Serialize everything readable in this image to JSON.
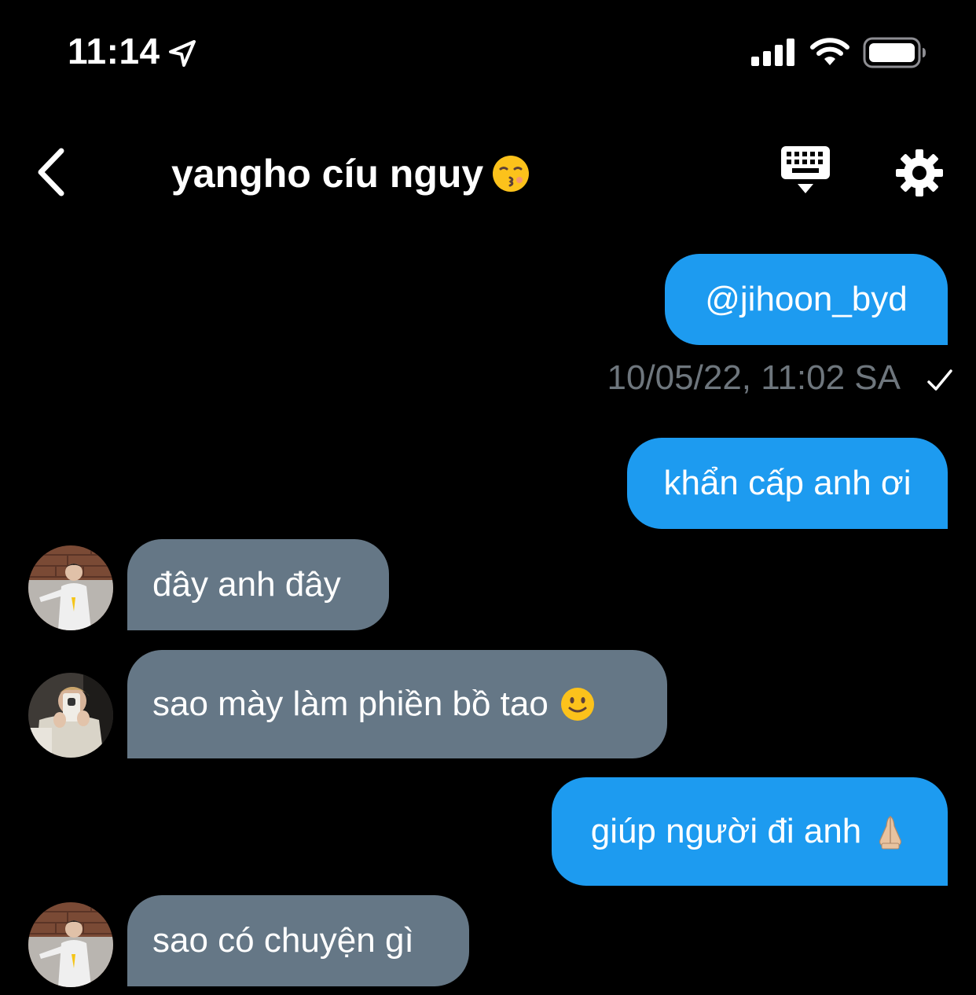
{
  "status_bar": {
    "time": "11:14",
    "location_icon": "location-arrow-icon",
    "signal_icon": "cellular-signal-icon",
    "wifi_icon": "wifi-icon",
    "battery_icon": "battery-icon"
  },
  "header": {
    "title": "yangho cíu nguy",
    "title_emoji": "kissing-face-emoji",
    "back_icon": "chevron-left-icon",
    "keyboard_icon": "keyboard-icon",
    "settings_icon": "gear-icon"
  },
  "messages": [
    {
      "direction": "sent",
      "text": "@jihoon_byd"
    },
    {
      "direction": "sent",
      "text": "khẩn cấp anh ơi"
    },
    {
      "direction": "received",
      "text": "đây anh đây"
    },
    {
      "direction": "received",
      "text": "sao mày làm phiền bồ tao",
      "emoji": "slightly-smiling-face-emoji"
    },
    {
      "direction": "sent",
      "text": "giúp người đi anh",
      "emoji": "folded-hands-emoji"
    },
    {
      "direction": "received",
      "text": "sao có chuyện gì"
    }
  ],
  "read_receipt": {
    "timestamp": "10/05/22, 11:02 SA",
    "icon": "checkmark-icon"
  },
  "colors": {
    "background": "#000000",
    "sent_bubble": "#1d9bf0",
    "received_bubble": "#657786",
    "timestamp_text": "#6e767d"
  }
}
